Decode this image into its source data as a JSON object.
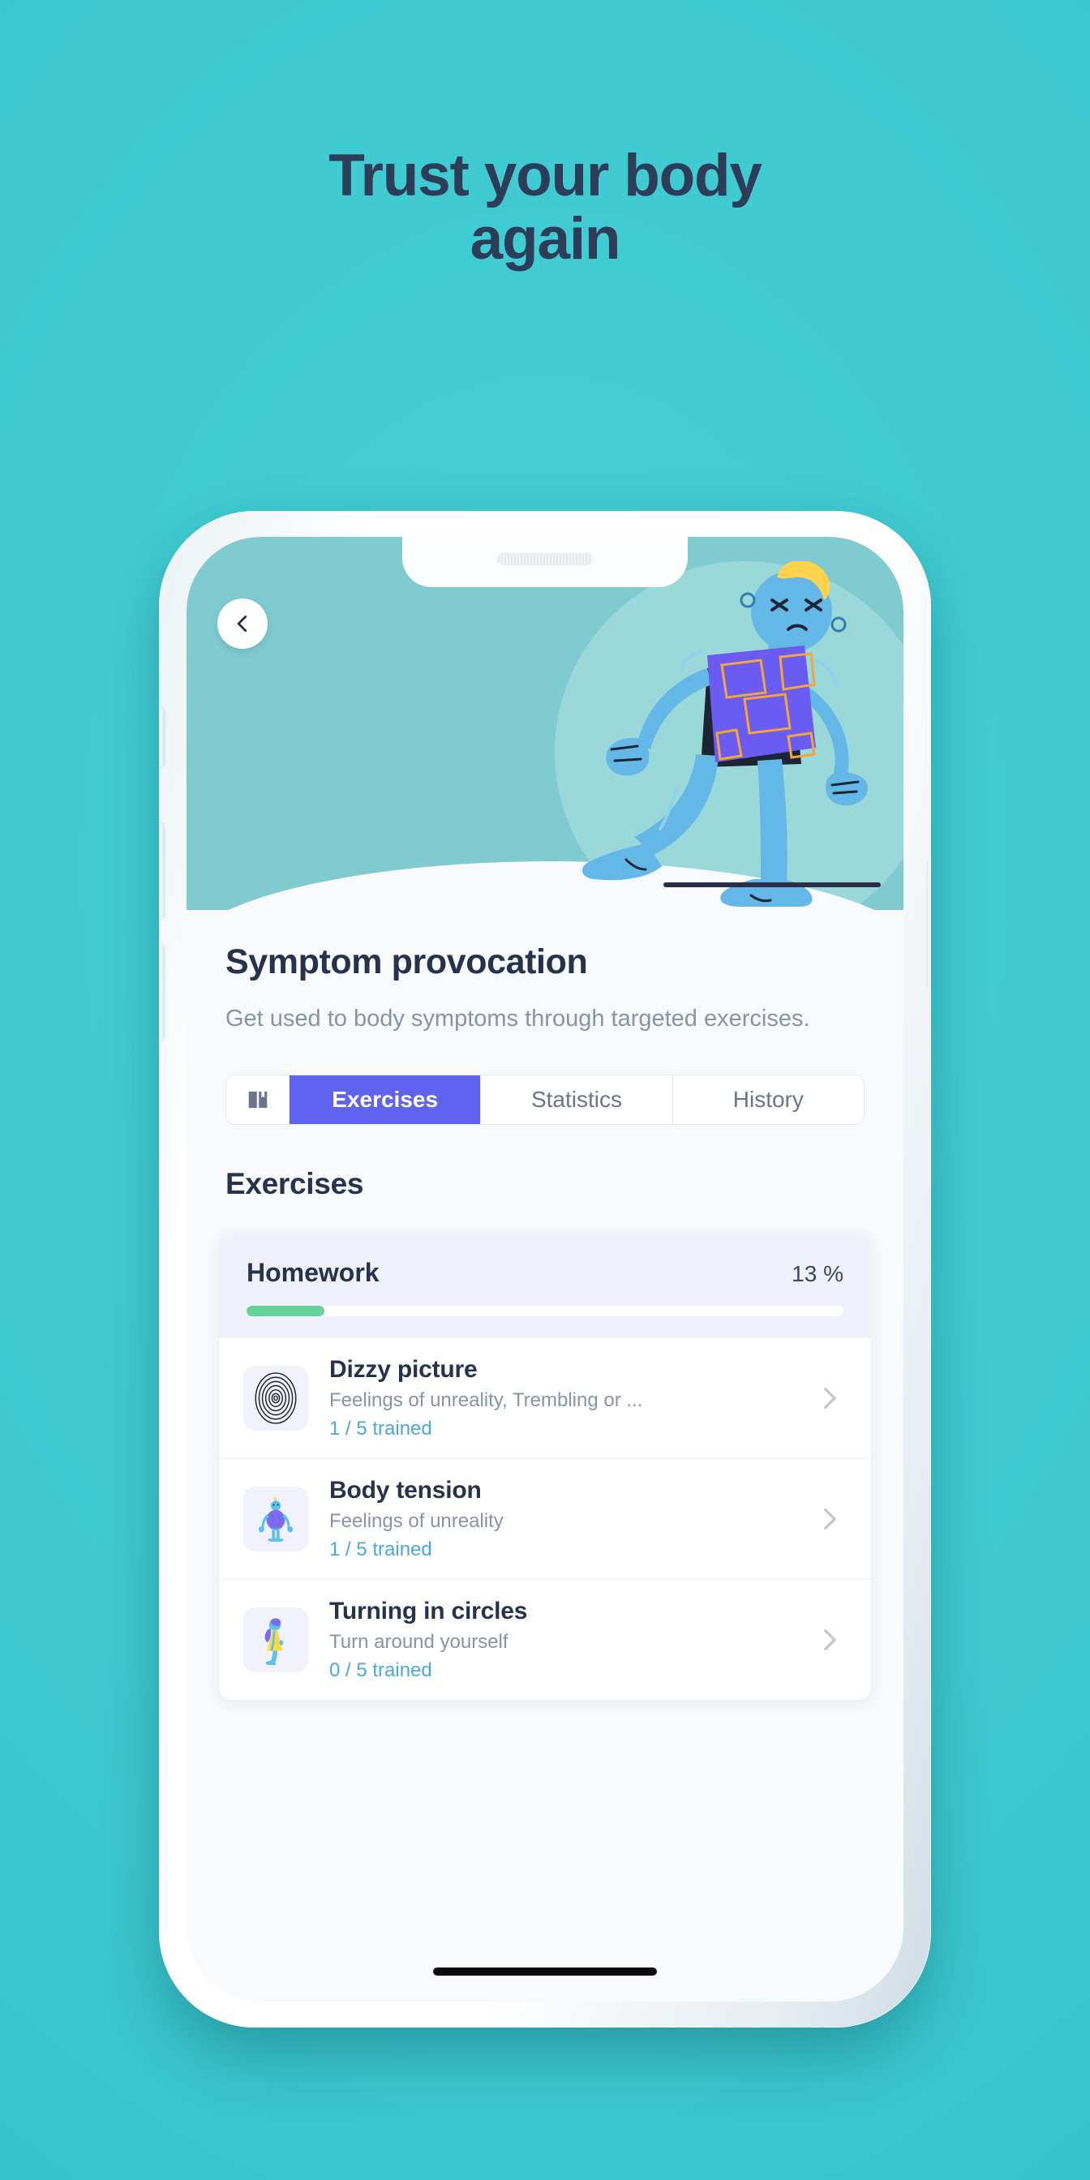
{
  "page": {
    "headline_line1": "Trust your body",
    "headline_line2": "again",
    "background_color": "#3ec9d1",
    "headline_color": "#2e3d57"
  },
  "phone": {
    "home_indicator": "home-indicator",
    "notch": "notch",
    "speaker": "speaker-grill"
  },
  "app": {
    "hero": {
      "back_button_icon": "chevron-left-icon",
      "illustration": "walking-character-illustration",
      "background_color": "#7fcbd0"
    },
    "title": "Symptom provocation",
    "subtitle": "Get used to body symptoms through targeted exercises.",
    "tabs": [
      {
        "label": "",
        "icon": "book-icon",
        "active": false
      },
      {
        "label": "Exercises",
        "icon": "",
        "active": true
      },
      {
        "label": "Statistics",
        "icon": "",
        "active": false
      },
      {
        "label": "History",
        "icon": "",
        "active": false
      }
    ],
    "active_tab_color": "#5f63ef",
    "section_title": "Exercises",
    "homework": {
      "label": "Homework",
      "percent_label": "13 %",
      "percent_value": 13,
      "bar_color": "#65d397"
    },
    "exercises": [
      {
        "title": "Dizzy picture",
        "subtitle": "Feelings of unreality, Trembling or ...",
        "progress": "1 / 5 trained",
        "icon": "spiral-icon",
        "chevron": "chevron-right-icon"
      },
      {
        "title": "Body tension",
        "subtitle": "Feelings of unreality",
        "progress": "1 / 5 trained",
        "icon": "standing-figure-icon",
        "chevron": "chevron-right-icon"
      },
      {
        "title": "Turning in circles",
        "subtitle": "Turn around yourself",
        "progress": "0 / 5 trained",
        "icon": "spinning-figure-icon",
        "chevron": "chevron-right-icon"
      }
    ],
    "progress_text_color": "#4aa8e0"
  }
}
